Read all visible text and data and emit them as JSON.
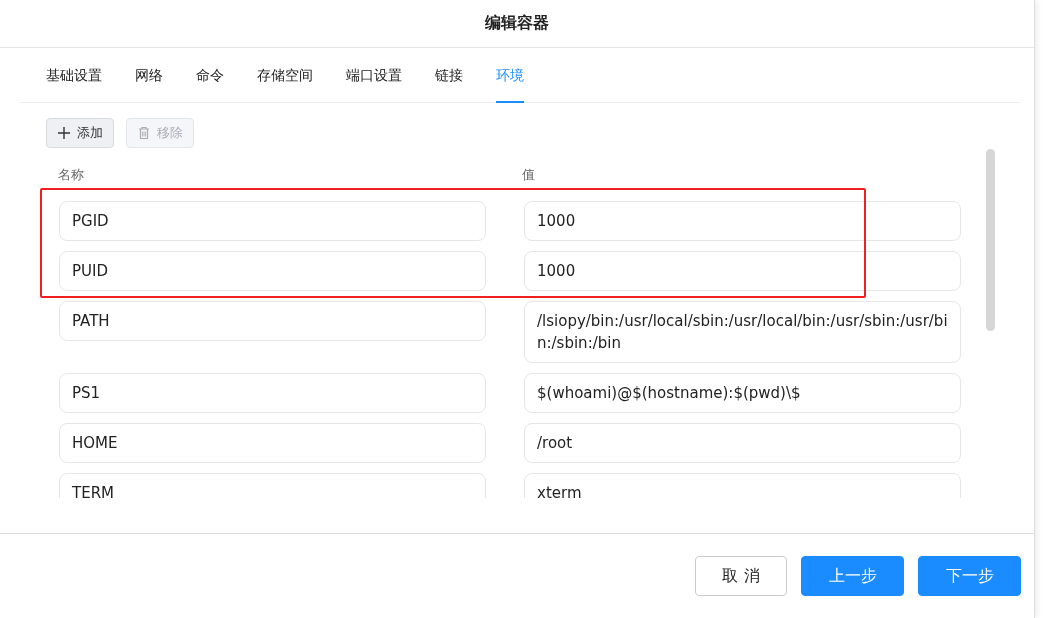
{
  "dialog": {
    "title": "编辑容器"
  },
  "tabs": [
    {
      "label": "基础设置",
      "selected": false
    },
    {
      "label": "网络",
      "selected": false
    },
    {
      "label": "命令",
      "selected": false
    },
    {
      "label": "存储空间",
      "selected": false
    },
    {
      "label": "端口设置",
      "selected": false
    },
    {
      "label": "链接",
      "selected": false
    },
    {
      "label": "环境",
      "selected": true
    }
  ],
  "toolbar": [
    {
      "label": "添加",
      "disabled": false
    },
    {
      "label": "移除",
      "disabled": true
    }
  ],
  "columns": [
    "名称",
    "值"
  ],
  "rows": [
    {
      "name": "PGID",
      "value": "1000",
      "highlighted": true
    },
    {
      "name": "PUID",
      "value": "1000",
      "highlighted": true
    },
    {
      "name": "PATH",
      "value": "/lsiopy/bin:/usr/local/sbin:/usr/local/bin:/usr/sbin:/usr/bin:/sbin:/bin",
      "highlighted": false
    },
    {
      "name": "PS1",
      "value": "$(whoami)@$(hostname):$(pwd)\\$",
      "highlighted": false
    },
    {
      "name": "HOME",
      "value": "/root",
      "highlighted": false
    },
    {
      "name": "TERM",
      "value": "xterm",
      "highlighted": false
    }
  ],
  "footer": [
    {
      "label": "取 消",
      "kind": "default"
    },
    {
      "label": "上一步",
      "kind": "primary"
    },
    {
      "label": "下一步",
      "kind": "primary"
    }
  ]
}
